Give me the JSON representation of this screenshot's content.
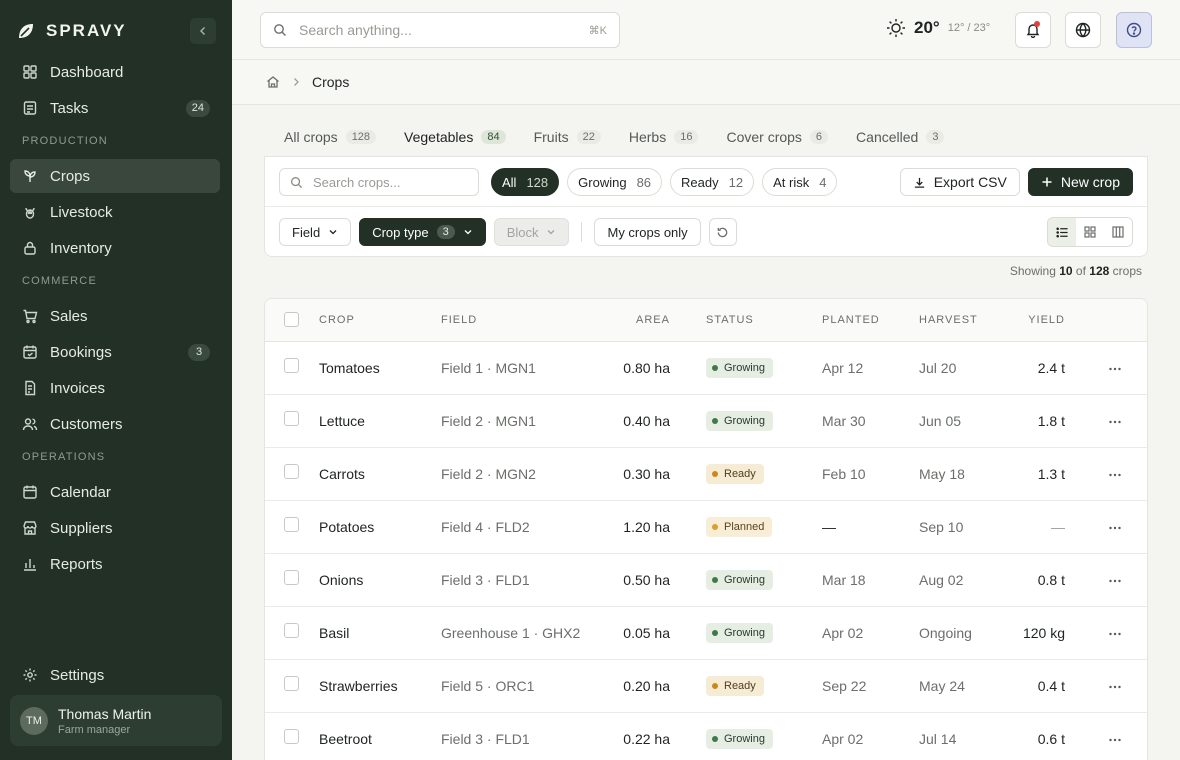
{
  "app": {
    "brand": "SPRAVY"
  },
  "sidebar": {
    "items_top": [
      {
        "label": "Dashboard",
        "icon": "grid-icon"
      },
      {
        "label": "Tasks",
        "icon": "list-icon",
        "badge": "24"
      }
    ],
    "sections": [
      {
        "title": "PRODUCTION",
        "items": [
          {
            "label": "Crops",
            "icon": "sprout-icon",
            "active": true
          },
          {
            "label": "Livestock",
            "icon": "livestock-icon"
          },
          {
            "label": "Inventory",
            "icon": "lock-icon"
          }
        ]
      },
      {
        "title": "COMMERCE",
        "items": [
          {
            "label": "Sales",
            "icon": "cart-icon"
          },
          {
            "label": "Bookings",
            "icon": "calendar-check-icon",
            "badge": "3"
          },
          {
            "label": "Invoices",
            "icon": "invoice-icon"
          },
          {
            "label": "Customers",
            "icon": "users-icon"
          }
        ]
      },
      {
        "title": "OPERATIONS",
        "items": [
          {
            "label": "Calendar",
            "icon": "calendar-icon"
          },
          {
            "label": "Suppliers",
            "icon": "store-icon"
          },
          {
            "label": "Reports",
            "icon": "bar-chart-icon"
          }
        ]
      }
    ],
    "settings_label": "Settings",
    "user": {
      "initials": "TM",
      "name": "Thomas Martin",
      "role": "Farm manager"
    }
  },
  "topbar": {
    "search_placeholder": "Search anything...",
    "search_shortcut": "⌘K",
    "weather": {
      "temp": "20°",
      "low": "12°",
      "high": "23°",
      "sep": "/"
    }
  },
  "breadcrumb": {
    "current": "Crops"
  },
  "tabs": [
    {
      "label": "All crops",
      "count": "128"
    },
    {
      "label": "Vegetables",
      "count": "84",
      "active": true
    },
    {
      "label": "Fruits",
      "count": "22"
    },
    {
      "label": "Herbs",
      "count": "16"
    },
    {
      "label": "Cover crops",
      "count": "6"
    },
    {
      "label": "Cancelled",
      "count": "3"
    }
  ],
  "toolbar": {
    "search_placeholder": "Search crops...",
    "chips": [
      {
        "label": "All",
        "count": "128",
        "active": true
      },
      {
        "label": "Growing",
        "count": "86"
      },
      {
        "label": "Ready",
        "count": "12"
      },
      {
        "label": "At risk",
        "count": "4"
      }
    ],
    "export_label": "Export CSV",
    "new_label": "New crop",
    "filters": {
      "field": "Field",
      "crop_type": "Crop type",
      "crop_type_count": "3",
      "block": "Block",
      "my_crops": "My crops only"
    },
    "view_mode": "list"
  },
  "showing": {
    "prefix": "Showing",
    "shown": "10",
    "of": "of",
    "total": "128",
    "suffix": "crops"
  },
  "table": {
    "headers": {
      "crop": "CROP",
      "field": "FIELD",
      "area": "AREA",
      "status": "STATUS",
      "planted": "PLANTED",
      "harvest": "HARVEST",
      "yield": "YIELD"
    },
    "rows": [
      {
        "crop": "Tomatoes",
        "field": "Field 1 · MGN1",
        "area": "0.80 ha",
        "status": "Growing",
        "planted": "Apr 12",
        "harvest": "Jul 20",
        "yield": "2.4 t"
      },
      {
        "crop": "Lettuce",
        "field": "Field 2 · MGN1",
        "area": "0.40 ha",
        "status": "Growing",
        "planted": "Mar 30",
        "harvest": "Jun 05",
        "yield": "1.8 t"
      },
      {
        "crop": "Carrots",
        "field": "Field 2 · MGN2",
        "area": "0.30 ha",
        "status": "Ready",
        "planted": "Feb 10",
        "harvest": "May 18",
        "yield": "1.3 t"
      },
      {
        "crop": "Potatoes",
        "field": "Field 4 · FLD2",
        "area": "1.20 ha",
        "status": "Planned",
        "planted": "—",
        "harvest": "Sep 10",
        "yield": "—"
      },
      {
        "crop": "Onions",
        "field": "Field 3 · FLD1",
        "area": "0.50 ha",
        "status": "Growing",
        "planted": "Mar 18",
        "harvest": "Aug 02",
        "yield": "0.8 t"
      },
      {
        "crop": "Basil",
        "field": "Greenhouse 1 · GHX2",
        "area": "0.05 ha",
        "status": "Growing",
        "planted": "Apr 02",
        "harvest": "Ongoing",
        "yield": "120 kg"
      },
      {
        "crop": "Strawberries",
        "field": "Field 5 · ORC1",
        "area": "0.20 ha",
        "status": "Ready",
        "planted": "Sep 22",
        "harvest": "May 24",
        "yield": "0.4 t"
      },
      {
        "crop": "Beetroot",
        "field": "Field 3 · FLD1",
        "area": "0.22 ha",
        "status": "Growing",
        "planted": "Apr 02",
        "harvest": "Jul 14",
        "yield": "0.6 t"
      }
    ]
  },
  "colors": {
    "sidebar_bg": "#223026",
    "accent": "#223026",
    "growing": "#3e7a46",
    "ready": "#c98a1a",
    "notif": "#e0413a"
  }
}
